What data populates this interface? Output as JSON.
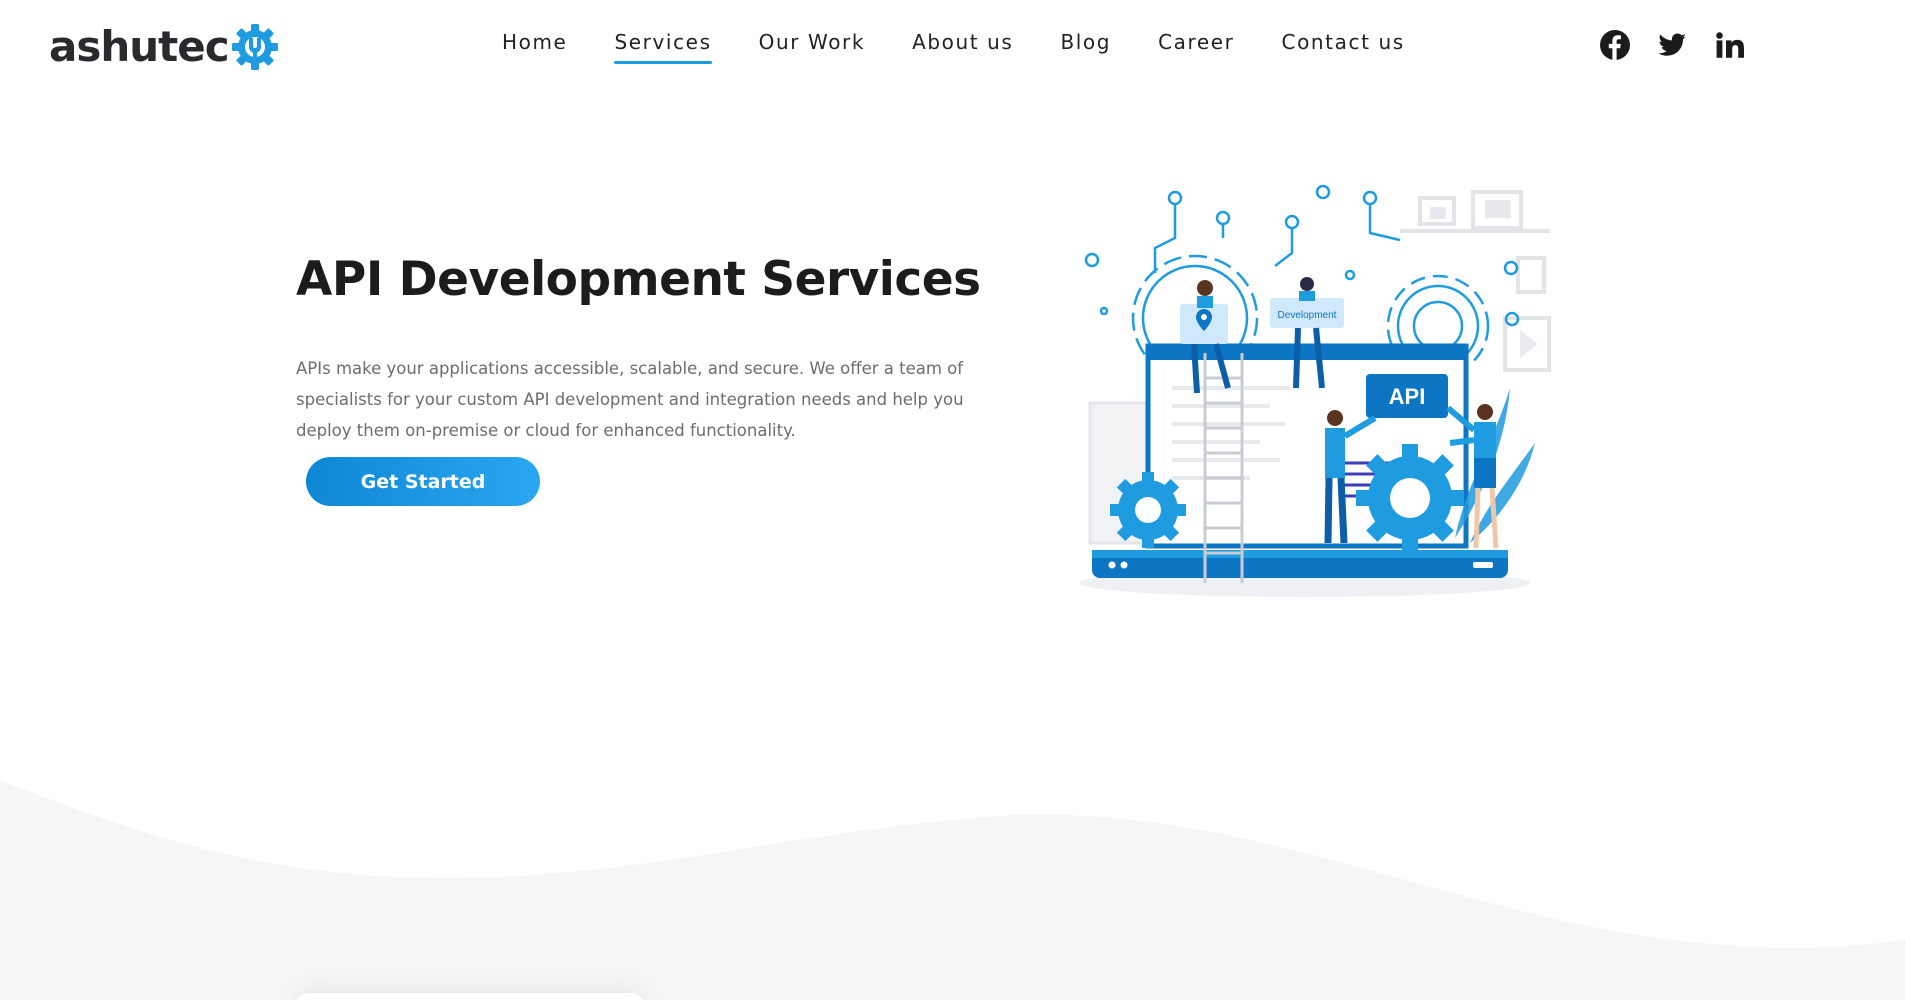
{
  "brand": {
    "name": "ashutec",
    "accent_color": "#1f9be0"
  },
  "nav": {
    "items": [
      {
        "label": "Home"
      },
      {
        "label": "Services",
        "active": true
      },
      {
        "label": "Our Work"
      },
      {
        "label": "About us"
      },
      {
        "label": "Blog"
      },
      {
        "label": "Career"
      },
      {
        "label": "Contact us"
      }
    ]
  },
  "social": [
    "facebook-icon",
    "twitter-icon",
    "linkedin-icon"
  ],
  "hero": {
    "title": "API Development Services",
    "description": "APIs make your applications accessible, scalable, and secure. We offer a team of specialists for your custom API development and integration needs and help you deploy them on-premise or cloud for enhanced functionality.",
    "cta_label": "Get Started",
    "illustration": {
      "api_label": "API",
      "dev_label": "Development"
    }
  }
}
